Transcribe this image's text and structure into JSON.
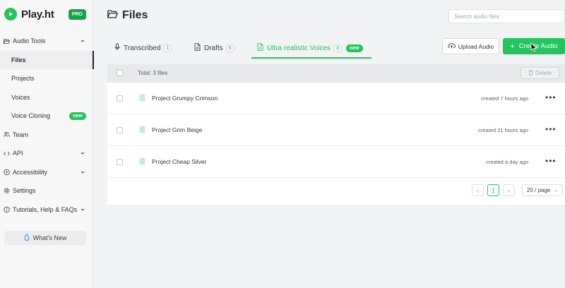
{
  "brand": {
    "name": "Play.ht",
    "badge": "PRO"
  },
  "sidebar": {
    "items": [
      {
        "label": "Audio Tools",
        "icon": "folder-open-icon",
        "has_chevron": true,
        "chevron": "up"
      },
      {
        "label": "Files",
        "sub": true,
        "active": true
      },
      {
        "label": "Projects",
        "sub": true
      },
      {
        "label": "Voices",
        "sub": true
      },
      {
        "label": "Voice Cloning",
        "sub": true,
        "badge": "new"
      },
      {
        "label": "Team",
        "icon": "users-icon"
      },
      {
        "label": "API",
        "icon": "code-icon",
        "has_chevron": true,
        "chevron": "down"
      },
      {
        "label": "Accessibility",
        "icon": "play-circle-icon",
        "has_chevron": true,
        "chevron": "down"
      },
      {
        "label": "Settings",
        "icon": "gear-icon"
      },
      {
        "label": "Tutorials, Help & FAQs",
        "icon": "info-icon",
        "has_chevron": true,
        "chevron": "down"
      }
    ],
    "whats_new": "What's New"
  },
  "header": {
    "title": "Files",
    "search_placeholder": "Search audio files"
  },
  "tabs": [
    {
      "label": "Transcribed",
      "count": "1",
      "icon": "microphone-icon"
    },
    {
      "label": "Drafts",
      "count": "6",
      "icon": "document-icon"
    },
    {
      "label": "Ultra realistic Voices",
      "count": "3",
      "icon": "document-icon",
      "active": true,
      "badge": "new"
    }
  ],
  "actions": {
    "upload": "Upload Audio",
    "create": "Create Audio"
  },
  "table": {
    "total": "Total: 3 files",
    "delete": "Delete",
    "rows": [
      {
        "name": "Project Grumpy Crimson",
        "created": "created 7 hours ago"
      },
      {
        "name": "Project Grim Beige",
        "created": "created 21 hours ago"
      },
      {
        "name": "Project Cheap Silver",
        "created": "created a day ago"
      }
    ],
    "more_label": "•••"
  },
  "pagination": {
    "prev": "‹",
    "current": "1",
    "next": "›",
    "page_size": "20 / page"
  },
  "colors": {
    "accent": "#22c55e",
    "sidebar_bg": "#f7f7f8",
    "page_bg": "#f2f3f4"
  }
}
